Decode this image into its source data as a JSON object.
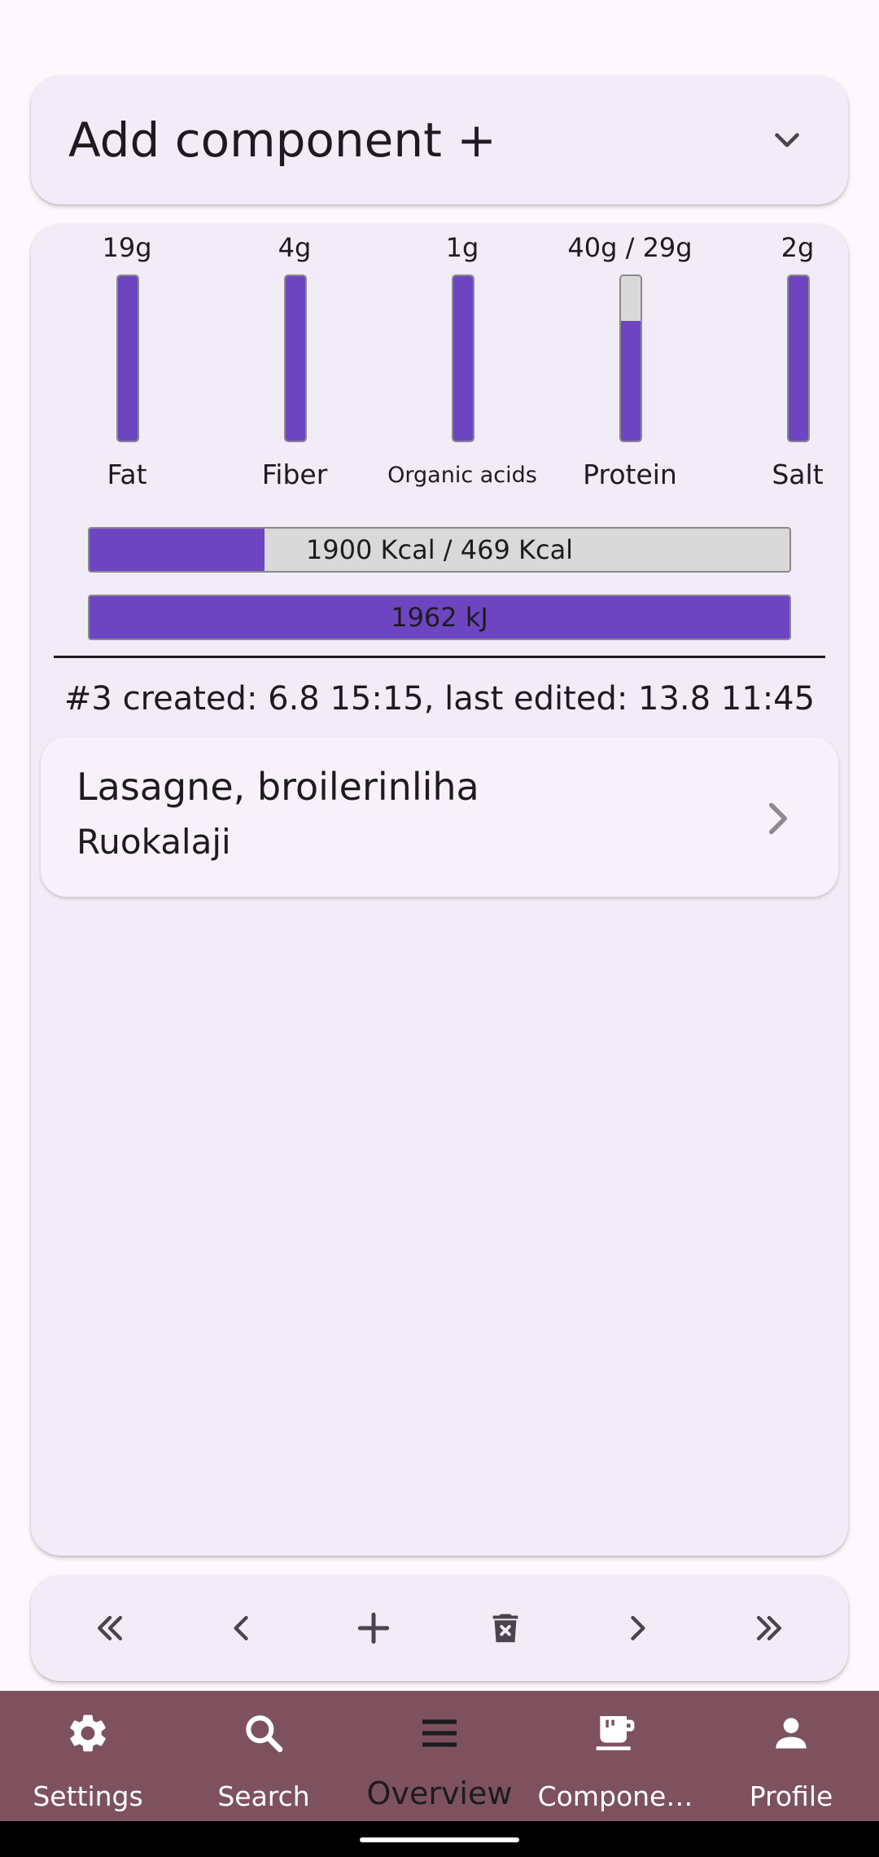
{
  "add_component": {
    "label": "Add component +"
  },
  "nutrients": [
    {
      "value": "19g",
      "name": "Fat",
      "fill": 1.0
    },
    {
      "value": "4g",
      "name": "Fiber",
      "fill": 1.0
    },
    {
      "value": "1g",
      "name": "Organic acids",
      "fill": 1.0
    },
    {
      "value": "40g / 29g",
      "name": "Protein",
      "fill": 0.73
    },
    {
      "value": "2g",
      "name": "Salt",
      "fill": 1.0
    }
  ],
  "energy": {
    "kcal_text": "1900 Kcal / 469 Kcal",
    "kcal_fill": 0.25,
    "kj_text": "1962 kJ",
    "kj_fill": 1.0
  },
  "meta": {
    "line": "#3 created: 6.8 15:15, last edited: 13.8 11:45"
  },
  "item": {
    "title": "Lasagne, broilerinliha",
    "subtitle": "Ruokalaji"
  },
  "toolbar": {
    "icons": [
      "first-page-icon",
      "previous-icon",
      "add-icon",
      "delete-icon",
      "next-icon",
      "last-page-icon"
    ]
  },
  "bottom_nav": {
    "items": [
      {
        "label": "Settings",
        "icon": "gear-icon"
      },
      {
        "label": "Search",
        "icon": "search-icon"
      },
      {
        "label": "Overview",
        "icon": "menu-icon",
        "active": true
      },
      {
        "label": "Compone…",
        "icon": "coffee-cup-icon"
      },
      {
        "label": "Profile",
        "icon": "person-icon"
      }
    ]
  },
  "colors": {
    "accent": "#6e45c1",
    "card": "#f1ecf8",
    "nav": "#7d525e",
    "background": "#fdf8fc"
  }
}
